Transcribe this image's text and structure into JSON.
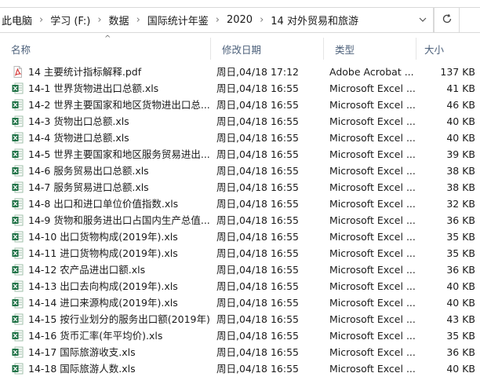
{
  "address_bar": {
    "crumbs": [
      "此电脑",
      "学习 (F:)",
      "数据",
      "国际统计年鉴",
      "2020",
      "14 对外贸易和旅游"
    ],
    "separator": "›",
    "dropdown_icon": "chevron-down-icon",
    "refresh_icon": "refresh-icon"
  },
  "columns": {
    "name": "名称",
    "date": "修改日期",
    "type": "类型",
    "size": "大小",
    "sort_indicator": "^"
  },
  "colors": {
    "header_text": "#4c607a",
    "excel_green": "#1e7145",
    "pdf_red": "#d32f2f"
  },
  "files": [
    {
      "name": "14 主要统计指标解释.pdf",
      "date": "周日,04/18 17:12",
      "type": "Adobe Acrobat ...",
      "size": "137 KB",
      "icon": "pdf-file-icon"
    },
    {
      "name": "14-1 世界货物进出口总额.xls",
      "date": "周日,04/18 16:55",
      "type": "Microsoft Excel ...",
      "size": "41 KB",
      "icon": "excel-file-icon"
    },
    {
      "name": "14-2 世界主要国家和地区货物进出口总...",
      "date": "周日,04/18 16:55",
      "type": "Microsoft Excel ...",
      "size": "46 KB",
      "icon": "excel-file-icon"
    },
    {
      "name": "14-3 货物出口总额.xls",
      "date": "周日,04/18 16:55",
      "type": "Microsoft Excel ...",
      "size": "40 KB",
      "icon": "excel-file-icon"
    },
    {
      "name": "14-4 货物进口总额.xls",
      "date": "周日,04/18 16:55",
      "type": "Microsoft Excel ...",
      "size": "40 KB",
      "icon": "excel-file-icon"
    },
    {
      "name": "14-5 世界主要国家和地区服务贸易进出...",
      "date": "周日,04/18 16:55",
      "type": "Microsoft Excel ...",
      "size": "39 KB",
      "icon": "excel-file-icon"
    },
    {
      "name": "14-6 服务贸易出口总额.xls",
      "date": "周日,04/18 16:55",
      "type": "Microsoft Excel ...",
      "size": "38 KB",
      "icon": "excel-file-icon"
    },
    {
      "name": "14-7 服务贸易进口总额.xls",
      "date": "周日,04/18 16:55",
      "type": "Microsoft Excel ...",
      "size": "38 KB",
      "icon": "excel-file-icon"
    },
    {
      "name": "14-8 出口和进口单位价值指数.xls",
      "date": "周日,04/18 16:55",
      "type": "Microsoft Excel ...",
      "size": "32 KB",
      "icon": "excel-file-icon"
    },
    {
      "name": "14-9 货物和服务进出口占国内生产总值...",
      "date": "周日,04/18 16:55",
      "type": "Microsoft Excel ...",
      "size": "36 KB",
      "icon": "excel-file-icon"
    },
    {
      "name": "14-10 出口货物构成(2019年).xls",
      "date": "周日,04/18 16:55",
      "type": "Microsoft Excel ...",
      "size": "35 KB",
      "icon": "excel-file-icon"
    },
    {
      "name": "14-11 进口货物构成(2019年).xls",
      "date": "周日,04/18 16:55",
      "type": "Microsoft Excel ...",
      "size": "35 KB",
      "icon": "excel-file-icon"
    },
    {
      "name": "14-12 农产品进出口额.xls",
      "date": "周日,04/18 16:55",
      "type": "Microsoft Excel ...",
      "size": "36 KB",
      "icon": "excel-file-icon"
    },
    {
      "name": "14-13 出口去向构成(2019年).xls",
      "date": "周日,04/18 16:55",
      "type": "Microsoft Excel ...",
      "size": "40 KB",
      "icon": "excel-file-icon"
    },
    {
      "name": "14-14 进口来源构成(2019年).xls",
      "date": "周日,04/18 16:55",
      "type": "Microsoft Excel ...",
      "size": "40 KB",
      "icon": "excel-file-icon"
    },
    {
      "name": "14-15 按行业划分的服务出口额(2019年)...",
      "date": "周日,04/18 16:55",
      "type": "Microsoft Excel ...",
      "size": "43 KB",
      "icon": "excel-file-icon"
    },
    {
      "name": "14-16 货币汇率(年平均价).xls",
      "date": "周日,04/18 16:55",
      "type": "Microsoft Excel ...",
      "size": "35 KB",
      "icon": "excel-file-icon"
    },
    {
      "name": "14-17 国际旅游收支.xls",
      "date": "周日,04/18 16:55",
      "type": "Microsoft Excel ...",
      "size": "36 KB",
      "icon": "excel-file-icon"
    },
    {
      "name": "14-18 国际旅游人数.xls",
      "date": "周日,04/18 16:55",
      "type": "Microsoft Excel ...",
      "size": "40 KB",
      "icon": "excel-file-icon"
    }
  ]
}
